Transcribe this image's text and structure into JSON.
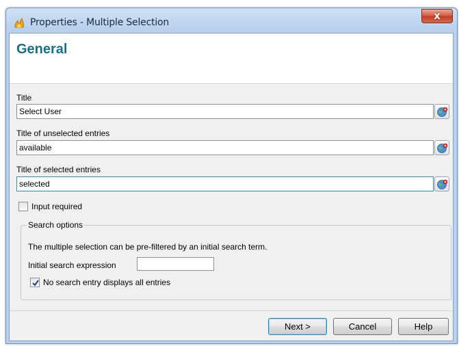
{
  "window": {
    "title": "Properties - Multiple Selection",
    "close_glyph": "x"
  },
  "header": {
    "title": "General"
  },
  "fields": {
    "title": {
      "label": "Title",
      "value": "Select User"
    },
    "unselected": {
      "label": "Title of unselected entries",
      "value": "available"
    },
    "selected": {
      "label": "Title of selected entries",
      "value": "selected"
    }
  },
  "input_required": {
    "label": "Input required",
    "checked": false
  },
  "search_options": {
    "legend": "Search options",
    "description": "The multiple selection can be pre-filtered by an initial search term.",
    "expression_label": "Initial search expression",
    "expression_value": "",
    "no_search_label": "No search entry displays all entries",
    "no_search_checked": true
  },
  "buttons": {
    "next": "Next >",
    "cancel": "Cancel",
    "help": "Help"
  },
  "icons": {
    "app": "app-flame-icon",
    "translate": "globe-translate-icon"
  },
  "colors": {
    "header_title": "#1a6f87",
    "accent_red": "#c23e25",
    "focus_border": "#3c8ea6"
  }
}
